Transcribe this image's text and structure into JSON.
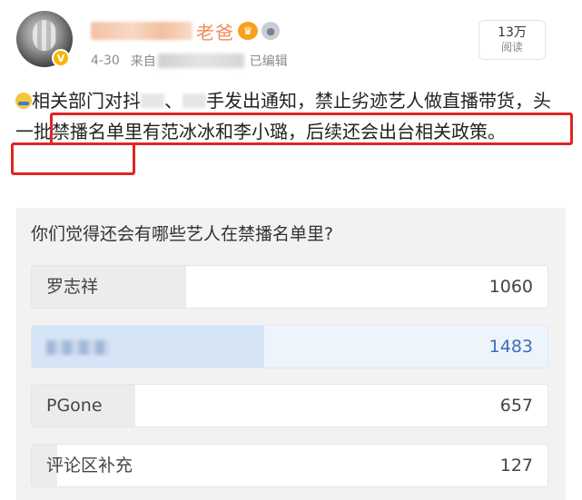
{
  "header": {
    "username_tail": "老爸",
    "date": "4-30",
    "source_prefix": "来自",
    "edited": "已编辑",
    "reads_count": "13万",
    "reads_label": "阅读"
  },
  "post": {
    "seg1": "相关部门对抖",
    "seg2": "、",
    "seg3": "手发出通知，禁止劣迹艺人做直播带货，",
    "highlight_line1": "头一批禁播名单里有范冰冰和李小璐，后续还会出台相",
    "highlight_line2": "关政策。"
  },
  "poll": {
    "question": "你们觉得还会有哪些艺人在禁播名单里?",
    "options": [
      {
        "label": "罗志祥",
        "count": "1060",
        "share": 0.3
      },
      {
        "label": "",
        "count": "1483",
        "share": 0.45
      },
      {
        "label": "PGone",
        "count": "657",
        "share": 0.2
      },
      {
        "label": "评论区补充",
        "count": "127",
        "share": 0.05
      }
    ]
  },
  "colors": {
    "highlight_border": "#e02424",
    "selected_count": "#3b6fb6",
    "name_accent": "#f08a5d"
  }
}
